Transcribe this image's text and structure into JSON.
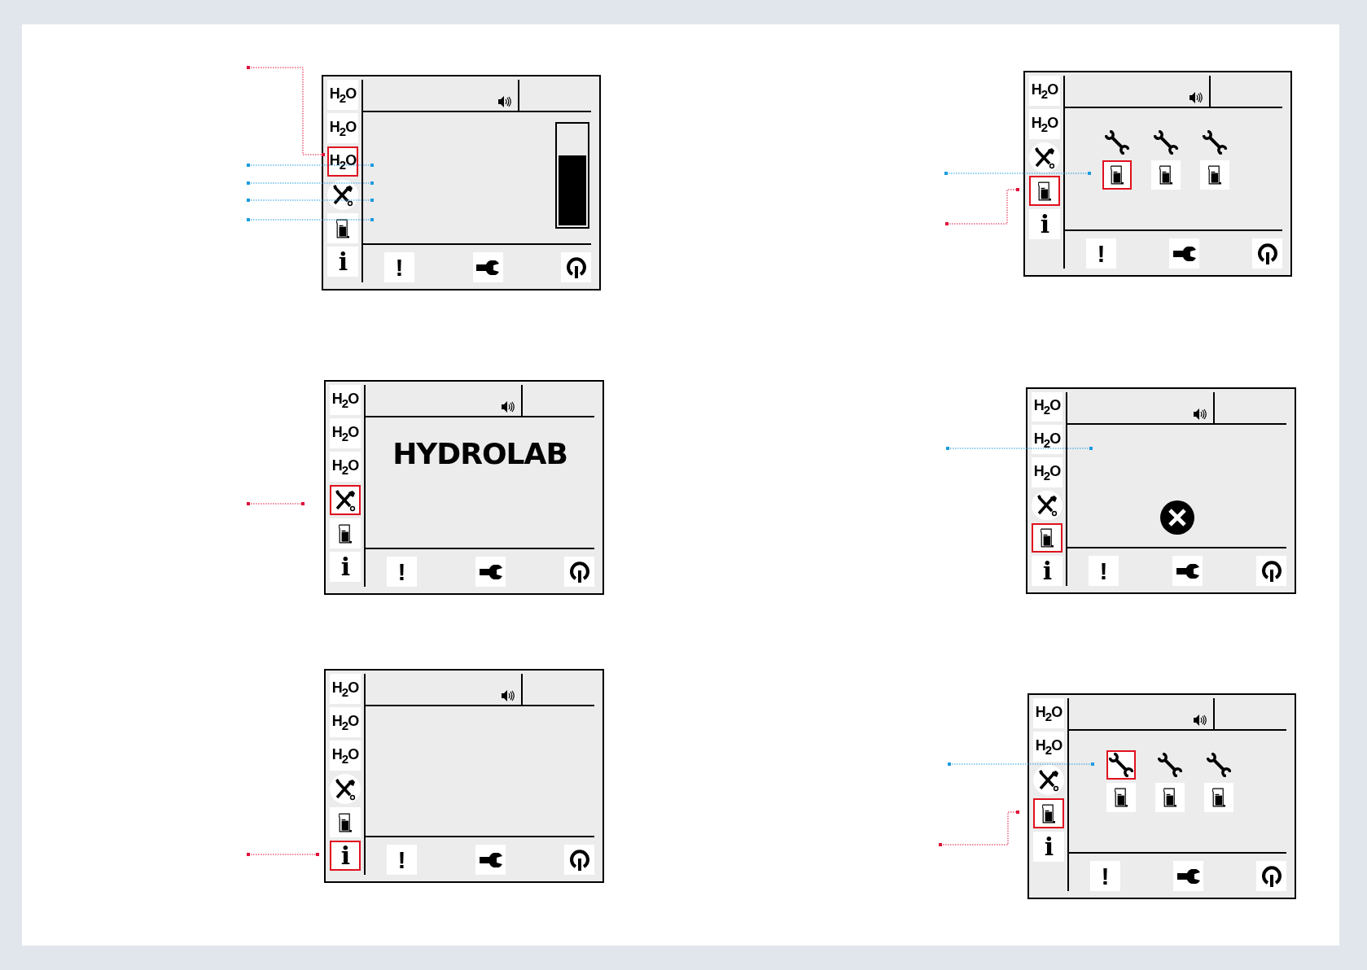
{
  "screens": [
    {
      "sidebar": [
        {
          "kind": "h2o",
          "label": "H$_{2}$O",
          "selected": false
        },
        {
          "kind": "h2o",
          "label": "H$_{2}$O",
          "selected": false
        },
        {
          "kind": "h2o",
          "label": "H$_{2}$O",
          "selected": true
        },
        {
          "kind": "tools",
          "selected": false
        },
        {
          "kind": "beaker",
          "selected": false
        },
        {
          "kind": "info",
          "label": "i",
          "selected": false
        }
      ],
      "content": {
        "kind": "level",
        "level": 0.7
      },
      "footer": [
        {
          "kind": "alert",
          "label": "!"
        },
        {
          "kind": "wrench"
        },
        {
          "kind": "power"
        }
      ]
    },
    {
      "sidebar": [
        {
          "kind": "h2o",
          "label": "H$_{2}$O",
          "selected": false
        },
        {
          "kind": "h2o",
          "label": "H$_{2}$O",
          "selected": false
        },
        {
          "kind": "tools",
          "selected": false
        },
        {
          "kind": "beaker",
          "selected": true
        },
        {
          "kind": "info",
          "label": "i",
          "selected": false
        }
      ],
      "content": {
        "kind": "grid",
        "tools": [
          {
            "selected": false
          },
          {
            "selected": false
          },
          {
            "selected": false
          }
        ],
        "beakers": [
          {
            "selected": true
          },
          {
            "selected": false
          },
          {
            "selected": false
          }
        ]
      },
      "footer": [
        {
          "kind": "alert",
          "label": "!"
        },
        {
          "kind": "wrench"
        },
        {
          "kind": "power"
        }
      ]
    },
    {
      "sidebar": [
        {
          "kind": "h2o",
          "label": "H$_{2}$O",
          "selected": false
        },
        {
          "kind": "h2o",
          "label": "H$_{2}$O",
          "selected": false
        },
        {
          "kind": "h2o",
          "label": "H$_{2}$O",
          "selected": false
        },
        {
          "kind": "tools",
          "selected": true
        },
        {
          "kind": "beaker",
          "selected": false
        },
        {
          "kind": "info",
          "label": "i",
          "selected": false
        }
      ],
      "content": {
        "kind": "logo",
        "text": "HYDROLAB"
      },
      "footer": [
        {
          "kind": "alert",
          "label": "!"
        },
        {
          "kind": "wrench"
        },
        {
          "kind": "power"
        }
      ]
    },
    {
      "sidebar": [
        {
          "kind": "h2o",
          "label": "H$_{2}$O",
          "selected": false
        },
        {
          "kind": "h2o",
          "label": "H$_{2}$O",
          "selected": false
        },
        {
          "kind": "h2o",
          "label": "H$_{2}$O",
          "selected": false
        },
        {
          "kind": "tools",
          "selected": false
        },
        {
          "kind": "beaker",
          "selected": true
        },
        {
          "kind": "info",
          "label": "i",
          "selected": false
        }
      ],
      "content": {
        "kind": "error"
      },
      "footer": [
        {
          "kind": "alert",
          "label": "!"
        },
        {
          "kind": "wrench"
        },
        {
          "kind": "power"
        }
      ]
    },
    {
      "sidebar": [
        {
          "kind": "h2o",
          "label": "H$_{2}$O",
          "selected": false
        },
        {
          "kind": "h2o",
          "label": "H$_{2}$O",
          "selected": false
        },
        {
          "kind": "h2o",
          "label": "H$_{2}$O",
          "selected": false
        },
        {
          "kind": "tools",
          "selected": false
        },
        {
          "kind": "beaker",
          "selected": false
        },
        {
          "kind": "info",
          "label": "i",
          "selected": true
        }
      ],
      "content": {
        "kind": "blank"
      },
      "footer": [
        {
          "kind": "alert",
          "label": "!"
        },
        {
          "kind": "wrench"
        },
        {
          "kind": "power"
        }
      ]
    },
    {
      "sidebar": [
        {
          "kind": "h2o",
          "label": "H$_{2}$O",
          "selected": false
        },
        {
          "kind": "h2o",
          "label": "H$_{2}$O",
          "selected": false
        },
        {
          "kind": "tools",
          "selected": false
        },
        {
          "kind": "beaker",
          "selected": true
        },
        {
          "kind": "info",
          "label": "i",
          "selected": false
        }
      ],
      "content": {
        "kind": "grid",
        "tools": [
          {
            "selected": true
          },
          {
            "selected": false
          },
          {
            "selected": false
          }
        ],
        "beakers": [
          {
            "selected": false
          },
          {
            "selected": false
          },
          {
            "selected": false
          }
        ]
      },
      "footer": [
        {
          "kind": "alert",
          "label": "!"
        },
        {
          "kind": "wrench"
        },
        {
          "kind": "power"
        }
      ]
    }
  ]
}
